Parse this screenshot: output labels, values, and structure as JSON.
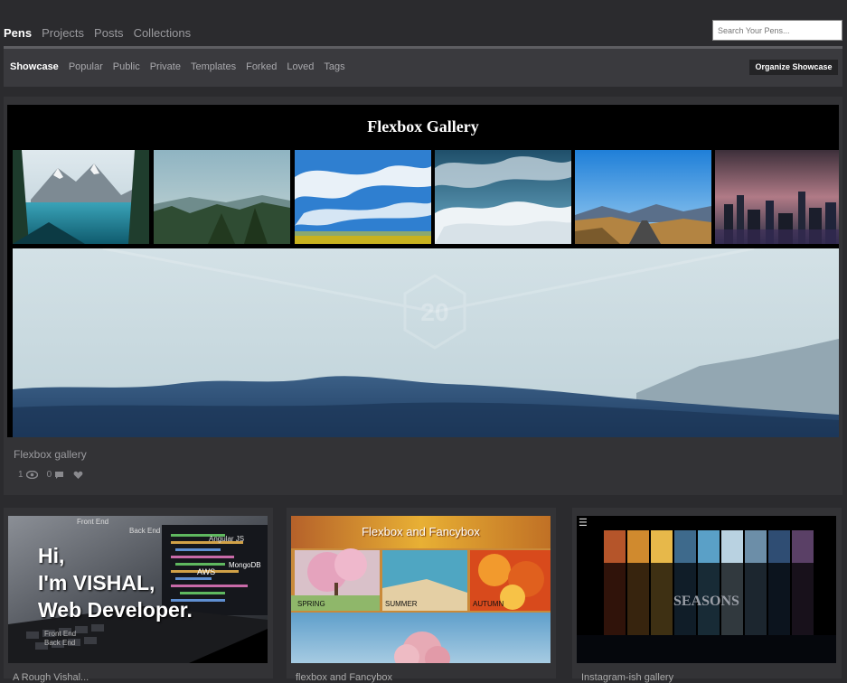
{
  "nav": {
    "tabs": [
      "Pens",
      "Projects",
      "Posts",
      "Collections"
    ],
    "active": "Pens",
    "search_placeholder": "Search Your Pens..."
  },
  "subnav": {
    "items": [
      "Showcase",
      "Popular",
      "Public",
      "Private",
      "Templates",
      "Forked",
      "Loved",
      "Tags"
    ],
    "active": "Showcase",
    "organize_label": "Organize Showcase"
  },
  "featured": {
    "preview_title": "Flexbox Gallery",
    "caption": "Flexbox gallery",
    "views": "1",
    "comments": "0"
  },
  "cards": [
    {
      "lines": [
        "Hi,",
        "I'm VISHAL,",
        "Web Developer."
      ],
      "tags": [
        "Front End",
        "Back End",
        "Angular JS",
        "AWS",
        "MongoDB",
        "Front End",
        "Back End"
      ],
      "title": "A Rough Vishal..."
    },
    {
      "heading": "Flexbox and Fancybox",
      "labels": [
        "SPRING",
        "SUMMER",
        "AUTUMN"
      ],
      "title": "flexbox and Fancybox"
    },
    {
      "heading": "SEASONS",
      "menu_glyph": "☰",
      "title": "Instagram-ish gallery"
    }
  ]
}
